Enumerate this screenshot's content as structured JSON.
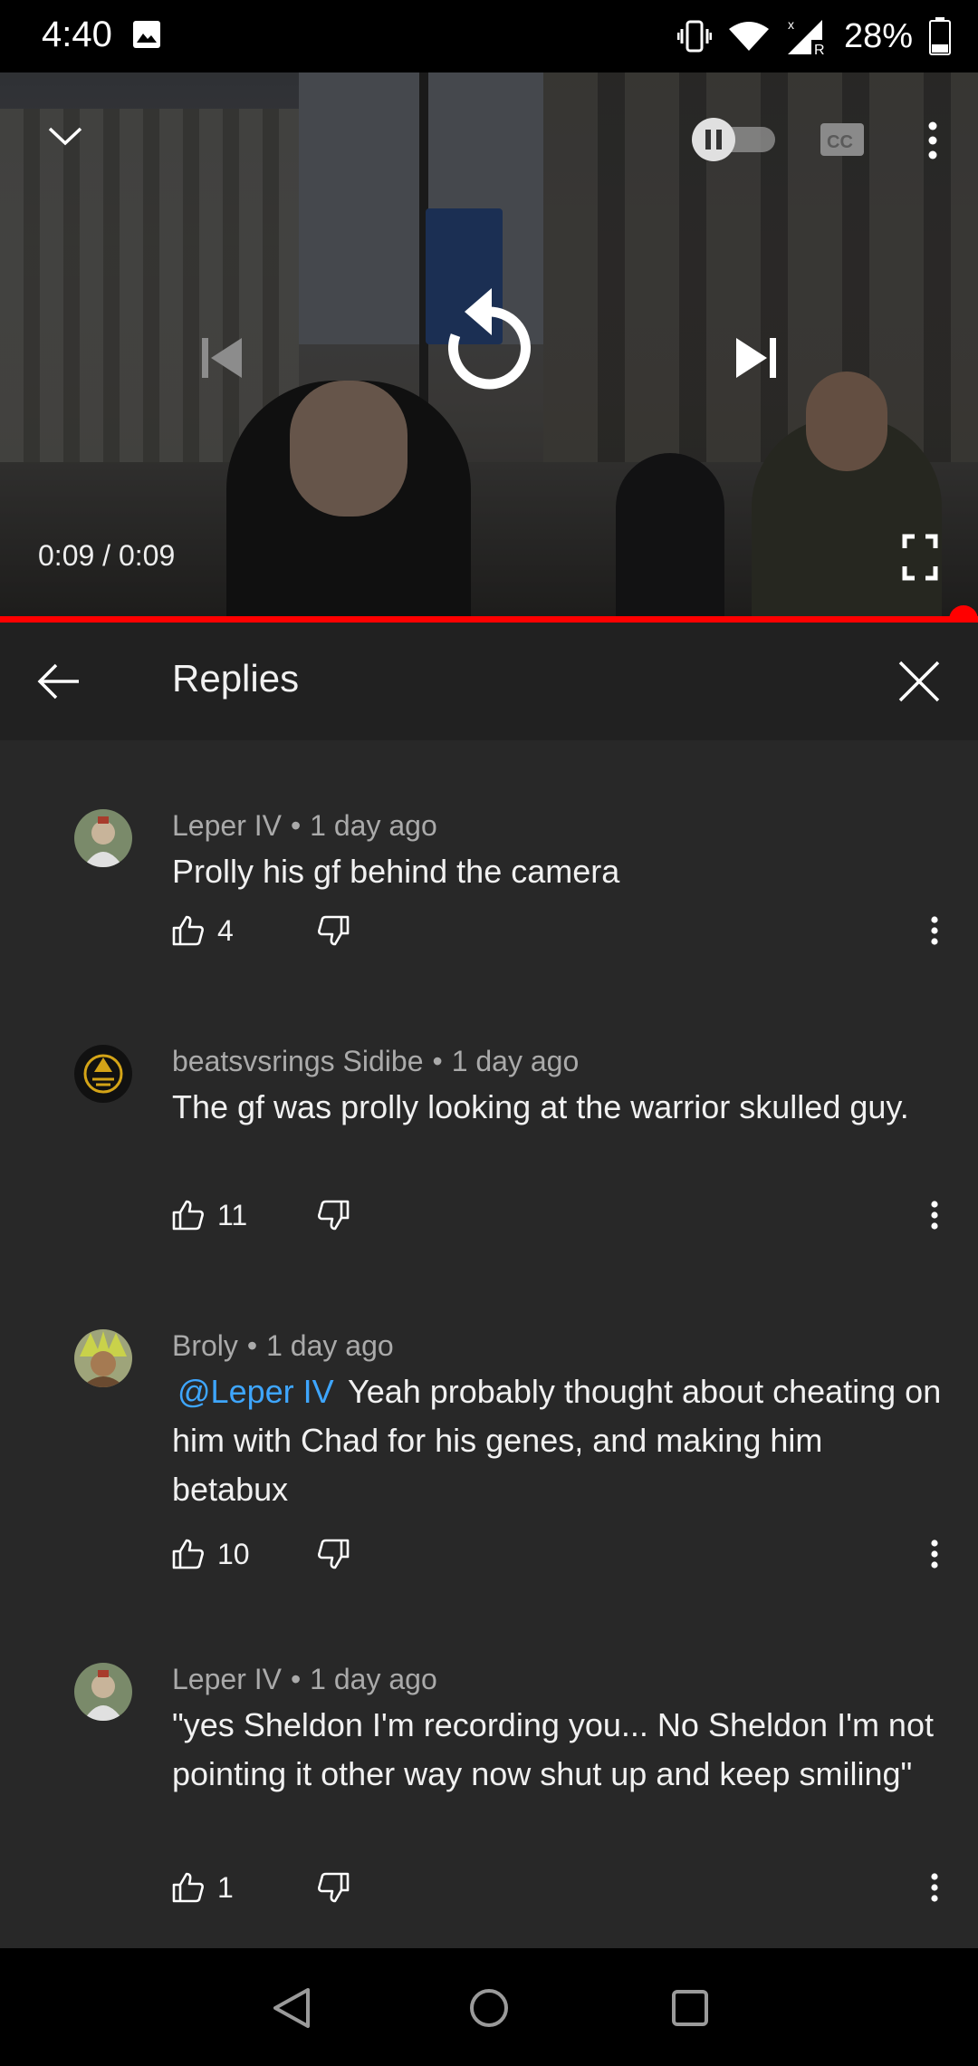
{
  "status_bar": {
    "time": "4:40",
    "battery": "28%",
    "network_badge": "R"
  },
  "player": {
    "time_display": "0:09 / 0:09",
    "progress": 1.0,
    "accent_color": "#ff0000"
  },
  "panel": {
    "title": "Replies"
  },
  "comments": [
    {
      "author": "Leper IV",
      "age": "1 day ago",
      "mention": "",
      "text": "Prolly his gf behind the camera",
      "likes": "4"
    },
    {
      "author": "beatsvsrings Sidibe",
      "age": "1 day ago",
      "mention": "",
      "text": "The gf was prolly looking at the warrior skulled guy.",
      "likes": "11"
    },
    {
      "author": "Broly",
      "age": "1 day ago",
      "mention": "@Leper IV",
      "text": "Yeah probably thought about cheating on him with Chad for his genes, and making him betabux",
      "likes": "10"
    },
    {
      "author": "Leper IV",
      "age": "1 day ago",
      "mention": "",
      "text": "\"yes Sheldon I'm recording you... No Sheldon I'm not pointing it other way now shut up and keep smiling\"",
      "likes": "1"
    }
  ],
  "colors": {
    "panel_bg": "#282828",
    "header_bg": "#212121",
    "meta_text": "#aaaaaa",
    "mention": "#3ea6ff"
  }
}
